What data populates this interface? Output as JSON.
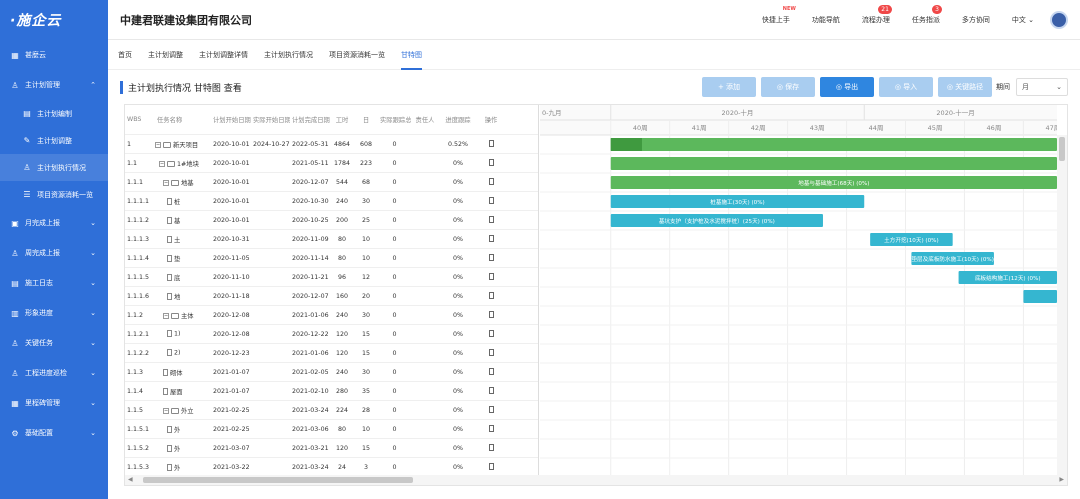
{
  "app": {
    "logo": "·施企云",
    "company": "中建君联建设集团有限公司"
  },
  "colors": {
    "sidebar": "#2f6fd8",
    "accent": "#2f86e0",
    "bar_green": "#5cb85c",
    "bar_green_dark": "#3f9a3f",
    "bar_teal": "#35b6d0"
  },
  "sidebar": {
    "items": [
      {
        "label": "甚麼云",
        "icon": "grid-icon",
        "chev": ""
      },
      {
        "label": "主计划管理",
        "icon": "hierarchy-icon",
        "chev": "⌃"
      },
      {
        "label": "主计划编制",
        "icon": "doc-icon",
        "chev": "",
        "sub": true
      },
      {
        "label": "主计划调整",
        "icon": "edit-icon",
        "chev": "",
        "sub": true
      },
      {
        "label": "主计划执行情况",
        "icon": "person-icon",
        "chev": "",
        "sub": true,
        "active": true
      },
      {
        "label": "项目资源消耗一览",
        "icon": "list-icon",
        "chev": "",
        "sub": true
      },
      {
        "label": "月完成上报",
        "icon": "calendar-icon",
        "chev": "⌄"
      },
      {
        "label": "周完成上报",
        "icon": "hierarchy-icon",
        "chev": "⌄"
      },
      {
        "label": "施工日志",
        "icon": "log-icon",
        "chev": "⌄"
      },
      {
        "label": "形象进度",
        "icon": "image-icon",
        "chev": "⌄"
      },
      {
        "label": "关键任务",
        "icon": "key-icon",
        "chev": "⌄"
      },
      {
        "label": "工程进度巡检",
        "icon": "inspect-icon",
        "chev": "⌄"
      },
      {
        "label": "里程碑管理",
        "icon": "milestone-icon",
        "chev": "⌄"
      },
      {
        "label": "基础配置",
        "icon": "gear-icon",
        "chev": "⌄"
      }
    ]
  },
  "header": {
    "links": [
      {
        "label": "快捷上手",
        "badge": "",
        "hot": "NEW"
      },
      {
        "label": "功能导航",
        "badge": "",
        "hot": ""
      },
      {
        "label": "流程办理",
        "badge": "21",
        "hot": ""
      },
      {
        "label": "任务指派",
        "badge": "3",
        "hot": ""
      },
      {
        "label": "多方协同",
        "badge": "",
        "hot": ""
      }
    ],
    "language": "中文 ⌄"
  },
  "tabs": [
    "首页",
    "主计划调整",
    "主计划调整详情",
    "主计划执行情况",
    "项目资源消耗一览",
    "甘特图"
  ],
  "active_tab": 5,
  "page": {
    "title": "主计划执行情况 甘特图 查看"
  },
  "toolbar": {
    "add": "+ 添加",
    "save": "◎ 保存",
    "export": "◎ 导出",
    "import": "◎ 导入",
    "critical": "◎ 关键路径",
    "period_label": "期间",
    "period_value": "月"
  },
  "grid": {
    "headers": [
      "WBS",
      "任务名称",
      "计划开始日期",
      "实际开始日期",
      "计划完成日期",
      "工时",
      "日",
      "实际跟踪总工",
      "责任人",
      "进度跟踪",
      "操作"
    ],
    "rows": [
      {
        "wbs": "1",
        "name": "新天项目",
        "ps": "2020-10-01",
        "as": "2024-10-27",
        "pe": "2022-05-31",
        "wd": "4864",
        "day": "608",
        "ac": "0",
        "prog": "0.52%",
        "icon": "fold"
      },
      {
        "wbs": "1.1",
        "name": "1#地块",
        "ps": "2020-10-01",
        "as": "",
        "pe": "2021-05-11",
        "wd": "1784",
        "day": "223",
        "ac": "0",
        "prog": "0%",
        "icon": "fold"
      },
      {
        "wbs": "1.1.1",
        "name": "地基",
        "ps": "2020-10-01",
        "as": "",
        "pe": "2020-12-07",
        "wd": "544",
        "day": "68",
        "ac": "0",
        "prog": "0%",
        "icon": "fold"
      },
      {
        "wbs": "1.1.1.1",
        "name": "桩",
        "ps": "2020-10-01",
        "as": "",
        "pe": "2020-10-30",
        "wd": "240",
        "day": "30",
        "ac": "0",
        "prog": "0%",
        "icon": "doc"
      },
      {
        "wbs": "1.1.1.2",
        "name": "基",
        "ps": "2020-10-01",
        "as": "",
        "pe": "2020-10-25",
        "wd": "200",
        "day": "25",
        "ac": "0",
        "prog": "0%",
        "icon": "doc"
      },
      {
        "wbs": "1.1.1.3",
        "name": "土",
        "ps": "2020-10-31",
        "as": "",
        "pe": "2020-11-09",
        "wd": "80",
        "day": "10",
        "ac": "0",
        "prog": "0%",
        "icon": "doc"
      },
      {
        "wbs": "1.1.1.4",
        "name": "垫",
        "ps": "2020-11-05",
        "as": "",
        "pe": "2020-11-14",
        "wd": "80",
        "day": "10",
        "ac": "0",
        "prog": "0%",
        "icon": "doc"
      },
      {
        "wbs": "1.1.1.5",
        "name": "底",
        "ps": "2020-11-10",
        "as": "",
        "pe": "2020-11-21",
        "wd": "96",
        "day": "12",
        "ac": "0",
        "prog": "0%",
        "icon": "doc"
      },
      {
        "wbs": "1.1.1.6",
        "name": "地",
        "ps": "2020-11-18",
        "as": "",
        "pe": "2020-12-07",
        "wd": "160",
        "day": "20",
        "ac": "0",
        "prog": "0%",
        "icon": "doc"
      },
      {
        "wbs": "1.1.2",
        "name": "主体",
        "ps": "2020-12-08",
        "as": "",
        "pe": "2021-01-06",
        "wd": "240",
        "day": "30",
        "ac": "0",
        "prog": "0%",
        "icon": "fold"
      },
      {
        "wbs": "1.1.2.1",
        "name": "1)",
        "ps": "2020-12-08",
        "as": "",
        "pe": "2020-12-22",
        "wd": "120",
        "day": "15",
        "ac": "0",
        "prog": "0%",
        "icon": "doc"
      },
      {
        "wbs": "1.1.2.2",
        "name": "2)",
        "ps": "2020-12-23",
        "as": "",
        "pe": "2021-01-06",
        "wd": "120",
        "day": "15",
        "ac": "0",
        "prog": "0%",
        "icon": "doc"
      },
      {
        "wbs": "1.1.3",
        "name": "砌体",
        "ps": "2021-01-07",
        "as": "",
        "pe": "2021-02-05",
        "wd": "240",
        "day": "30",
        "ac": "0",
        "prog": "0%",
        "icon": "doc"
      },
      {
        "wbs": "1.1.4",
        "name": "屋面",
        "ps": "2021-01-07",
        "as": "",
        "pe": "2021-02-10",
        "wd": "280",
        "day": "35",
        "ac": "0",
        "prog": "0%",
        "icon": "doc"
      },
      {
        "wbs": "1.1.5",
        "name": "外立",
        "ps": "2021-02-25",
        "as": "",
        "pe": "2021-03-24",
        "wd": "224",
        "day": "28",
        "ac": "0",
        "prog": "0%",
        "icon": "fold"
      },
      {
        "wbs": "1.1.5.1",
        "name": "外",
        "ps": "2021-02-25",
        "as": "",
        "pe": "2021-03-06",
        "wd": "80",
        "day": "10",
        "ac": "0",
        "prog": "0%",
        "icon": "doc"
      },
      {
        "wbs": "1.1.5.2",
        "name": "外",
        "ps": "2021-03-07",
        "as": "",
        "pe": "2021-03-21",
        "wd": "120",
        "day": "15",
        "ac": "0",
        "prog": "0%",
        "icon": "doc"
      },
      {
        "wbs": "1.1.5.3",
        "name": "外",
        "ps": "2021-03-22",
        "as": "",
        "pe": "2021-03-24",
        "wd": "24",
        "day": "3",
        "ac": "0",
        "prog": "0%",
        "icon": "doc"
      }
    ]
  },
  "gantt": {
    "months": [
      {
        "label": "0-九月",
        "week_start": 38.8
      },
      {
        "label": "2020-十月",
        "week_start": 40
      },
      {
        "label": "2020-十一月",
        "week_start": 44.3
      }
    ],
    "weeks": [
      "40周",
      "41周",
      "42周",
      "43周",
      "44周",
      "45周",
      "46周",
      "47周"
    ],
    "week_range": [
      38.8,
      47.4
    ],
    "bars": [
      {
        "row": 0,
        "start": 40.0,
        "end": 47.6,
        "color": "green",
        "label": "",
        "progress": 0.07
      },
      {
        "row": 1,
        "start": 40.0,
        "end": 47.6,
        "color": "green",
        "label": "",
        "progress": 0
      },
      {
        "row": 2,
        "start": 40.0,
        "end": 47.6,
        "color": "green",
        "label": "地基与基础施工(68天) (0%)",
        "progress": 0
      },
      {
        "row": 3,
        "start": 40.0,
        "end": 44.3,
        "color": "teal",
        "label": "桩基施工(30天) (0%)",
        "progress": 0
      },
      {
        "row": 4,
        "start": 40.0,
        "end": 43.6,
        "color": "teal",
        "label": "基坑支护（支护桩及水泥搅拌桩）(25天) (0%)",
        "progress": 0
      },
      {
        "row": 5,
        "start": 44.4,
        "end": 45.8,
        "color": "teal",
        "label": "土方开挖(10天) (0%)",
        "progress": 0
      },
      {
        "row": 6,
        "start": 45.1,
        "end": 46.5,
        "color": "teal",
        "label": "垫层及底板防水施工(10天) (0%)",
        "progress": 0
      },
      {
        "row": 7,
        "start": 45.9,
        "end": 47.6,
        "color": "teal",
        "label": "底板结构施工(12天) (0%)",
        "progress": 0
      },
      {
        "row": 8,
        "start": 47.0,
        "end": 47.6,
        "color": "teal",
        "label": "",
        "progress": 0
      }
    ]
  }
}
